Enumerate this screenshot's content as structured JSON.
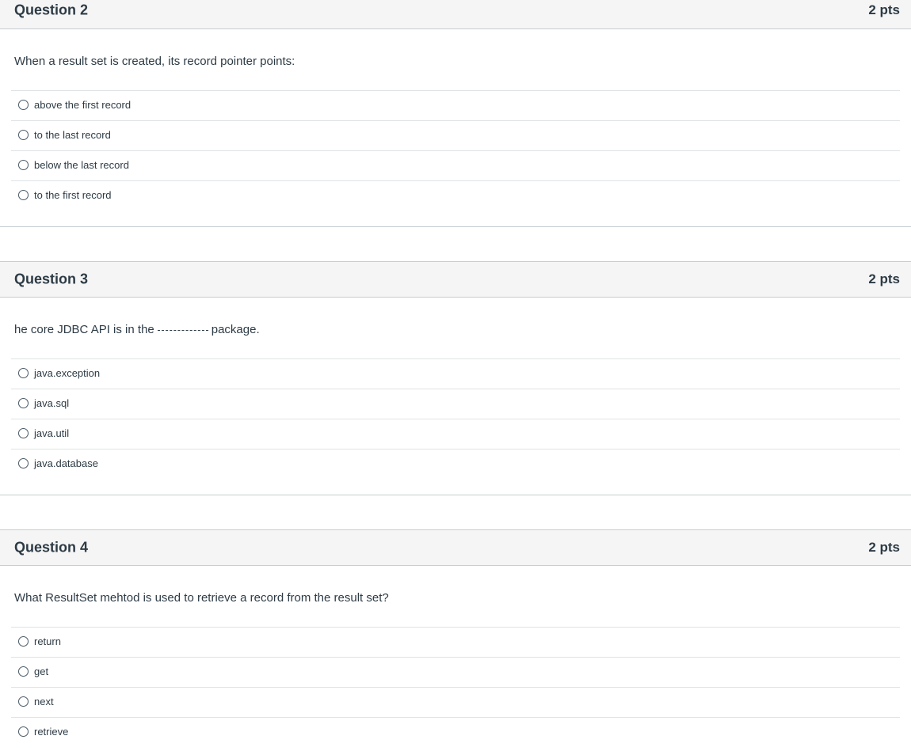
{
  "questions": [
    {
      "title": "Question 2",
      "points": "2 pts",
      "text": "When a result set is created, its record pointer points:",
      "answers": [
        "above the first record",
        "to the last record",
        "below the last record",
        "to the first record"
      ]
    },
    {
      "title": "Question 3",
      "points": "2 pts",
      "text_before": "he core JDBC API is in the",
      "text_after": "package.",
      "answers": [
        "java.exception",
        "java.sql",
        "java.util",
        "java.database"
      ]
    },
    {
      "title": "Question 4",
      "points": "2 pts",
      "text": "What ResultSet mehtod is used to retrieve a record from the result set?",
      "answers": [
        "return",
        "get",
        "next",
        "retrieve"
      ]
    }
  ]
}
